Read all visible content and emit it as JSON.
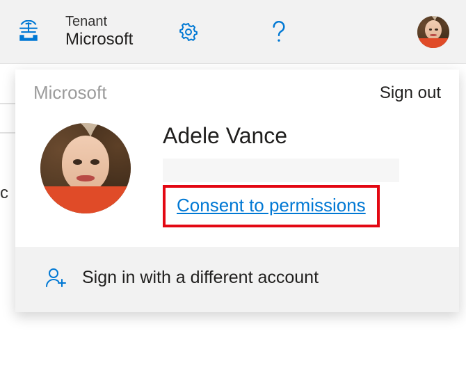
{
  "header": {
    "tenant_label": "Tenant",
    "tenant_name": "Microsoft"
  },
  "bg": {
    "cutoff_char": "c"
  },
  "flyout": {
    "org_label": "Microsoft",
    "sign_out": "Sign out",
    "display_name": "Adele Vance",
    "consent_link": "Consent to permissions",
    "alt_signin": "Sign in with a different account"
  }
}
